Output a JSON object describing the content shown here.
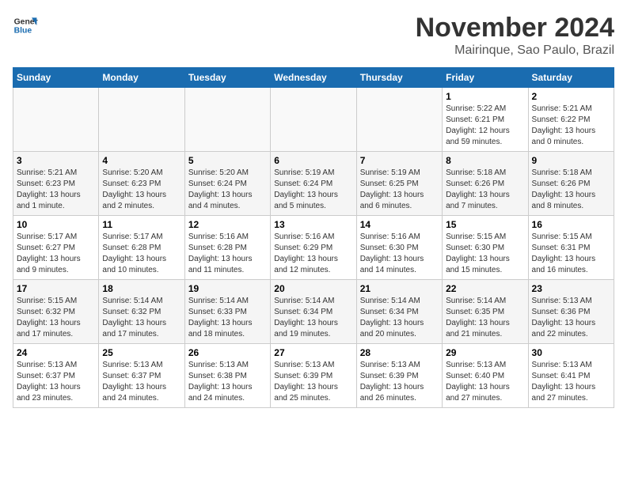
{
  "logo": {
    "line1": "General",
    "line2": "Blue"
  },
  "title": "November 2024",
  "subtitle": "Mairinque, Sao Paulo, Brazil",
  "days_of_week": [
    "Sunday",
    "Monday",
    "Tuesday",
    "Wednesday",
    "Thursday",
    "Friday",
    "Saturday"
  ],
  "weeks": [
    [
      {
        "day": "",
        "info": ""
      },
      {
        "day": "",
        "info": ""
      },
      {
        "day": "",
        "info": ""
      },
      {
        "day": "",
        "info": ""
      },
      {
        "day": "",
        "info": ""
      },
      {
        "day": "1",
        "info": "Sunrise: 5:22 AM\nSunset: 6:21 PM\nDaylight: 12 hours and 59 minutes."
      },
      {
        "day": "2",
        "info": "Sunrise: 5:21 AM\nSunset: 6:22 PM\nDaylight: 13 hours and 0 minutes."
      }
    ],
    [
      {
        "day": "3",
        "info": "Sunrise: 5:21 AM\nSunset: 6:23 PM\nDaylight: 13 hours and 1 minute."
      },
      {
        "day": "4",
        "info": "Sunrise: 5:20 AM\nSunset: 6:23 PM\nDaylight: 13 hours and 2 minutes."
      },
      {
        "day": "5",
        "info": "Sunrise: 5:20 AM\nSunset: 6:24 PM\nDaylight: 13 hours and 4 minutes."
      },
      {
        "day": "6",
        "info": "Sunrise: 5:19 AM\nSunset: 6:24 PM\nDaylight: 13 hours and 5 minutes."
      },
      {
        "day": "7",
        "info": "Sunrise: 5:19 AM\nSunset: 6:25 PM\nDaylight: 13 hours and 6 minutes."
      },
      {
        "day": "8",
        "info": "Sunrise: 5:18 AM\nSunset: 6:26 PM\nDaylight: 13 hours and 7 minutes."
      },
      {
        "day": "9",
        "info": "Sunrise: 5:18 AM\nSunset: 6:26 PM\nDaylight: 13 hours and 8 minutes."
      }
    ],
    [
      {
        "day": "10",
        "info": "Sunrise: 5:17 AM\nSunset: 6:27 PM\nDaylight: 13 hours and 9 minutes."
      },
      {
        "day": "11",
        "info": "Sunrise: 5:17 AM\nSunset: 6:28 PM\nDaylight: 13 hours and 10 minutes."
      },
      {
        "day": "12",
        "info": "Sunrise: 5:16 AM\nSunset: 6:28 PM\nDaylight: 13 hours and 11 minutes."
      },
      {
        "day": "13",
        "info": "Sunrise: 5:16 AM\nSunset: 6:29 PM\nDaylight: 13 hours and 12 minutes."
      },
      {
        "day": "14",
        "info": "Sunrise: 5:16 AM\nSunset: 6:30 PM\nDaylight: 13 hours and 14 minutes."
      },
      {
        "day": "15",
        "info": "Sunrise: 5:15 AM\nSunset: 6:30 PM\nDaylight: 13 hours and 15 minutes."
      },
      {
        "day": "16",
        "info": "Sunrise: 5:15 AM\nSunset: 6:31 PM\nDaylight: 13 hours and 16 minutes."
      }
    ],
    [
      {
        "day": "17",
        "info": "Sunrise: 5:15 AM\nSunset: 6:32 PM\nDaylight: 13 hours and 17 minutes."
      },
      {
        "day": "18",
        "info": "Sunrise: 5:14 AM\nSunset: 6:32 PM\nDaylight: 13 hours and 17 minutes."
      },
      {
        "day": "19",
        "info": "Sunrise: 5:14 AM\nSunset: 6:33 PM\nDaylight: 13 hours and 18 minutes."
      },
      {
        "day": "20",
        "info": "Sunrise: 5:14 AM\nSunset: 6:34 PM\nDaylight: 13 hours and 19 minutes."
      },
      {
        "day": "21",
        "info": "Sunrise: 5:14 AM\nSunset: 6:34 PM\nDaylight: 13 hours and 20 minutes."
      },
      {
        "day": "22",
        "info": "Sunrise: 5:14 AM\nSunset: 6:35 PM\nDaylight: 13 hours and 21 minutes."
      },
      {
        "day": "23",
        "info": "Sunrise: 5:13 AM\nSunset: 6:36 PM\nDaylight: 13 hours and 22 minutes."
      }
    ],
    [
      {
        "day": "24",
        "info": "Sunrise: 5:13 AM\nSunset: 6:37 PM\nDaylight: 13 hours and 23 minutes."
      },
      {
        "day": "25",
        "info": "Sunrise: 5:13 AM\nSunset: 6:37 PM\nDaylight: 13 hours and 24 minutes."
      },
      {
        "day": "26",
        "info": "Sunrise: 5:13 AM\nSunset: 6:38 PM\nDaylight: 13 hours and 24 minutes."
      },
      {
        "day": "27",
        "info": "Sunrise: 5:13 AM\nSunset: 6:39 PM\nDaylight: 13 hours and 25 minutes."
      },
      {
        "day": "28",
        "info": "Sunrise: 5:13 AM\nSunset: 6:39 PM\nDaylight: 13 hours and 26 minutes."
      },
      {
        "day": "29",
        "info": "Sunrise: 5:13 AM\nSunset: 6:40 PM\nDaylight: 13 hours and 27 minutes."
      },
      {
        "day": "30",
        "info": "Sunrise: 5:13 AM\nSunset: 6:41 PM\nDaylight: 13 hours and 27 minutes."
      }
    ]
  ]
}
